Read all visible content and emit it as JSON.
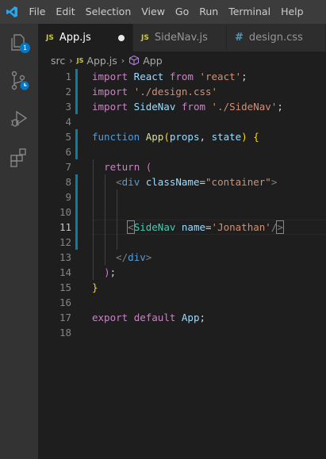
{
  "menu": [
    "File",
    "Edit",
    "Selection",
    "View",
    "Go",
    "Run",
    "Terminal",
    "Help"
  ],
  "activity": {
    "source_control_badge": "1"
  },
  "tabs": [
    {
      "icon": "JS",
      "label": "App.js",
      "active": true,
      "modified": true
    },
    {
      "icon": "JS",
      "label": "SideNav.js",
      "active": false
    },
    {
      "icon": "#",
      "label": "design.css",
      "active": false
    }
  ],
  "breadcrumb": {
    "folder": "src",
    "file_icon": "JS",
    "file": "App.js",
    "symbol": "App"
  },
  "current_line": 11,
  "lines": [
    {
      "n": "1",
      "t": [
        [
          "import",
          "ctl"
        ],
        [
          " React ",
          "id"
        ],
        [
          "from",
          "ctl"
        ],
        [
          " ",
          "plain"
        ],
        [
          "'react'",
          "str"
        ],
        [
          ";",
          "plain"
        ]
      ]
    },
    {
      "n": "2",
      "t": [
        [
          "import",
          "ctl"
        ],
        [
          " ",
          "plain"
        ],
        [
          "'./design.css'",
          "str"
        ]
      ]
    },
    {
      "n": "3",
      "t": [
        [
          "import",
          "ctl"
        ],
        [
          " SideNav ",
          "id"
        ],
        [
          "from",
          "ctl"
        ],
        [
          " ",
          "plain"
        ],
        [
          "'./SideNav'",
          "str"
        ],
        [
          ";",
          "plain"
        ]
      ]
    },
    {
      "n": "4",
      "t": []
    },
    {
      "n": "5",
      "t": [
        [
          "function",
          "kw"
        ],
        [
          " ",
          "plain"
        ],
        [
          "App",
          "fn"
        ],
        [
          "(",
          "br"
        ],
        [
          "props",
          "id"
        ],
        [
          ", ",
          "plain"
        ],
        [
          "state",
          "id"
        ],
        [
          ")",
          "br"
        ],
        [
          " ",
          "plain"
        ],
        [
          "{",
          "br"
        ]
      ]
    },
    {
      "n": "6",
      "t": []
    },
    {
      "n": "7",
      "t": [
        [
          "  ",
          "plain"
        ],
        [
          "return",
          "ctl"
        ],
        [
          " ",
          "plain"
        ],
        [
          "(",
          "brp"
        ]
      ]
    },
    {
      "n": "8",
      "t": [
        [
          "    ",
          "plain"
        ],
        [
          "<",
          "punc"
        ],
        [
          "div",
          "htag"
        ],
        [
          " ",
          "plain"
        ],
        [
          "className",
          "id"
        ],
        [
          "=",
          "plain"
        ],
        [
          "\"container\"",
          "str"
        ],
        [
          ">",
          "punc"
        ]
      ]
    },
    {
      "n": "9",
      "t": []
    },
    {
      "n": "10",
      "t": []
    },
    {
      "n": "11",
      "t": [
        [
          "      ",
          "plain"
        ],
        [
          "<",
          "punc match"
        ],
        [
          "SideNav",
          "tag"
        ],
        [
          " ",
          "plain"
        ],
        [
          "name",
          "id"
        ],
        [
          "=",
          "plain"
        ],
        [
          "'Jonathan'",
          "str"
        ],
        [
          "/",
          "punc"
        ],
        [
          ">",
          "punc match"
        ]
      ]
    },
    {
      "n": "12",
      "t": []
    },
    {
      "n": "13",
      "t": [
        [
          "    ",
          "plain"
        ],
        [
          "</",
          "punc"
        ],
        [
          "div",
          "htag"
        ],
        [
          ">",
          "punc"
        ]
      ]
    },
    {
      "n": "14",
      "t": [
        [
          "  ",
          "plain"
        ],
        [
          ")",
          "brp"
        ],
        [
          ";",
          "plain"
        ]
      ]
    },
    {
      "n": "15",
      "t": [
        [
          "}",
          "br"
        ]
      ]
    },
    {
      "n": "16",
      "t": []
    },
    {
      "n": "17",
      "t": [
        [
          "export",
          "ctl"
        ],
        [
          " ",
          "plain"
        ],
        [
          "default",
          "ctl"
        ],
        [
          " App",
          "id"
        ],
        [
          ";",
          "plain"
        ]
      ]
    },
    {
      "n": "18",
      "t": []
    }
  ],
  "colors": {
    "titlebar": "#3c3c3c",
    "activitybar": "#333333",
    "editor": "#1e1e1e",
    "accent": "#0c7d9d",
    "badge": "#007acc",
    "logo": "#23a9f2"
  }
}
